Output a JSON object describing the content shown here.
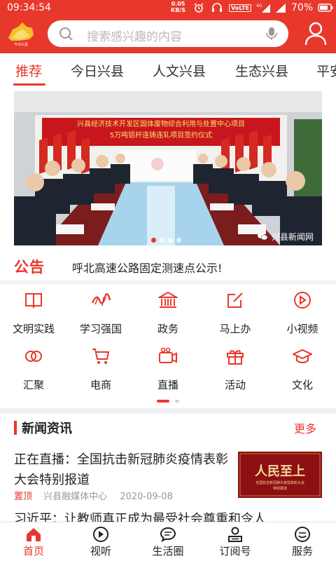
{
  "status_bar": {
    "time": "09:34:54",
    "net_speed_value": "0.05",
    "net_speed_unit": "KB/S",
    "volte": "VoLTE",
    "network": "4G",
    "battery": "70%"
  },
  "header": {
    "logo_text": "今日兴县",
    "search_placeholder": "搜索感兴趣的内容"
  },
  "tabs": [
    {
      "label": "推荐"
    },
    {
      "label": "今日兴县"
    },
    {
      "label": "人文兴县"
    },
    {
      "label": "生态兴县"
    },
    {
      "label": "平安"
    }
  ],
  "banner": {
    "sign_line1": "兴县经济技术开发区固体废物综合利用与处置中心项目",
    "sign_line2": "5万吨铝杆连铸连轧项目签约仪式",
    "watermark": "兴县新闻网",
    "slide_count": 4,
    "active_slide": 0
  },
  "notice": {
    "badge": "公告",
    "text": "呼北高速公路固定测速点公示!"
  },
  "quick_grid": [
    {
      "label": "文明实践",
      "icon": "book-icon"
    },
    {
      "label": "学习强国",
      "icon": "xuexi-qiangguo-icon"
    },
    {
      "label": "政务",
      "icon": "government-building-icon"
    },
    {
      "label": "马上办",
      "icon": "edit-icon"
    },
    {
      "label": "小视频",
      "icon": "play-circle-icon"
    },
    {
      "label": "汇聚",
      "icon": "rings-icon"
    },
    {
      "label": "电商",
      "icon": "cart-icon"
    },
    {
      "label": "直播",
      "icon": "camera-icon"
    },
    {
      "label": "活动",
      "icon": "gift-icon"
    },
    {
      "label": "文化",
      "icon": "graduation-cap-icon"
    }
  ],
  "news": {
    "section_title": "新闻资讯",
    "more": "更多",
    "items": [
      {
        "title": "正在直播：全国抗击新冠肺炎疫情表彰大会特别报道",
        "tag": "置顶",
        "source": "兴县融媒体中心",
        "date": "2020-09-08",
        "thumb_text": "人民至上",
        "thumb_subtext": "全国抗击新冠肺炎疫情表彰大会",
        "thumb_subtext2": "特别报道"
      },
      {
        "title": "习近平：让教师真正成为最受社会尊重和令人"
      }
    ]
  },
  "bottom_nav": [
    {
      "label": "首页",
      "icon": "home-icon"
    },
    {
      "label": "视听",
      "icon": "play-icon"
    },
    {
      "label": "生活圈",
      "icon": "chat-icon"
    },
    {
      "label": "订阅号",
      "icon": "subscribe-icon"
    },
    {
      "label": "服务",
      "icon": "service-icon"
    }
  ],
  "colors": {
    "brand": "#e8382c",
    "text": "#222222",
    "muted": "#999999"
  }
}
